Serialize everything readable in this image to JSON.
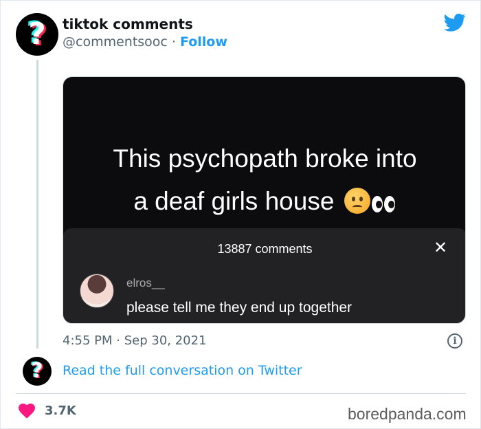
{
  "author": {
    "name": "tiktok comments",
    "handle": "@commentsooc",
    "separator": "·",
    "follow_label": "Follow",
    "avatar_glyph": "?"
  },
  "brand_icon": "twitter-bird-icon",
  "media": {
    "title_line1": "This psychopath broke into",
    "title_line2": "a deaf girls house",
    "emoji": [
      "worried-face-icon",
      "eyes-icon"
    ],
    "panel": {
      "count_label": "13887 comments",
      "close_glyph": "✕",
      "comment_user": "elros__",
      "comment_text": "please tell me they end up together"
    }
  },
  "meta": {
    "time": "4:55 PM",
    "dot": "·",
    "date": "Sep 30, 2021",
    "info_glyph": "i"
  },
  "read_full": {
    "avatar_glyph": "?",
    "label": "Read the full conversation on Twitter"
  },
  "footer": {
    "likes": "3.7K",
    "watermark": "boredpanda.com"
  },
  "colors": {
    "accent": "#1d9bf0",
    "heart": "#f91880",
    "text_secondary": "#536471",
    "tiktok_cyan": "#25f4ee",
    "tiktok_red": "#fe2c55"
  }
}
